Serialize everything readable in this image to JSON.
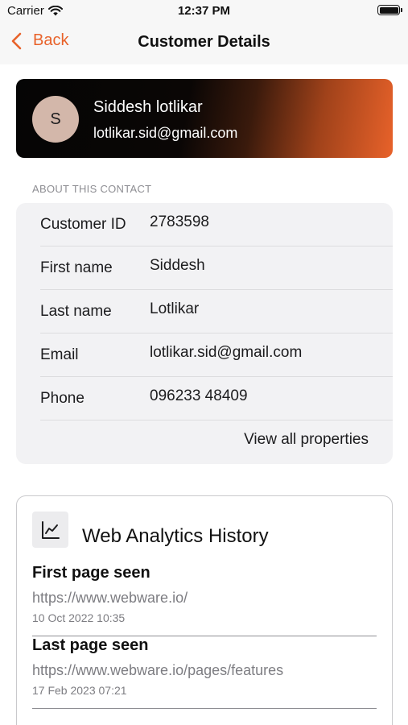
{
  "status_bar": {
    "carrier": "Carrier",
    "time": "12:37 PM"
  },
  "nav": {
    "back_label": "Back",
    "title": "Customer Details"
  },
  "profile": {
    "initial": "S",
    "name": "Siddesh lotlikar",
    "email": "lotlikar.sid@gmail.com"
  },
  "about": {
    "header": "ABOUT THIS CONTACT",
    "rows": [
      {
        "label": "Customer ID",
        "value": "2783598"
      },
      {
        "label": "First name",
        "value": "Siddesh"
      },
      {
        "label": "Last name",
        "value": "Lotlikar"
      },
      {
        "label": "Email",
        "value": "lotlikar.sid@gmail.com"
      },
      {
        "label": "Phone",
        "value": "096233 48409"
      }
    ],
    "view_all": "View all properties"
  },
  "analytics": {
    "title": "Web Analytics History",
    "icon": "line-chart-icon",
    "pages": [
      {
        "heading": "First page seen",
        "url": "https://www.webware.io/",
        "date": "10 Oct 2022 10:35"
      },
      {
        "heading": "Last page seen",
        "url": "https://www.webware.io/pages/features",
        "date": "17 Feb 2023 07:21"
      }
    ]
  },
  "colors": {
    "accent": "#e8622a",
    "avatar_bg": "#d3b7aa",
    "card_bg": "#f2f2f4"
  }
}
